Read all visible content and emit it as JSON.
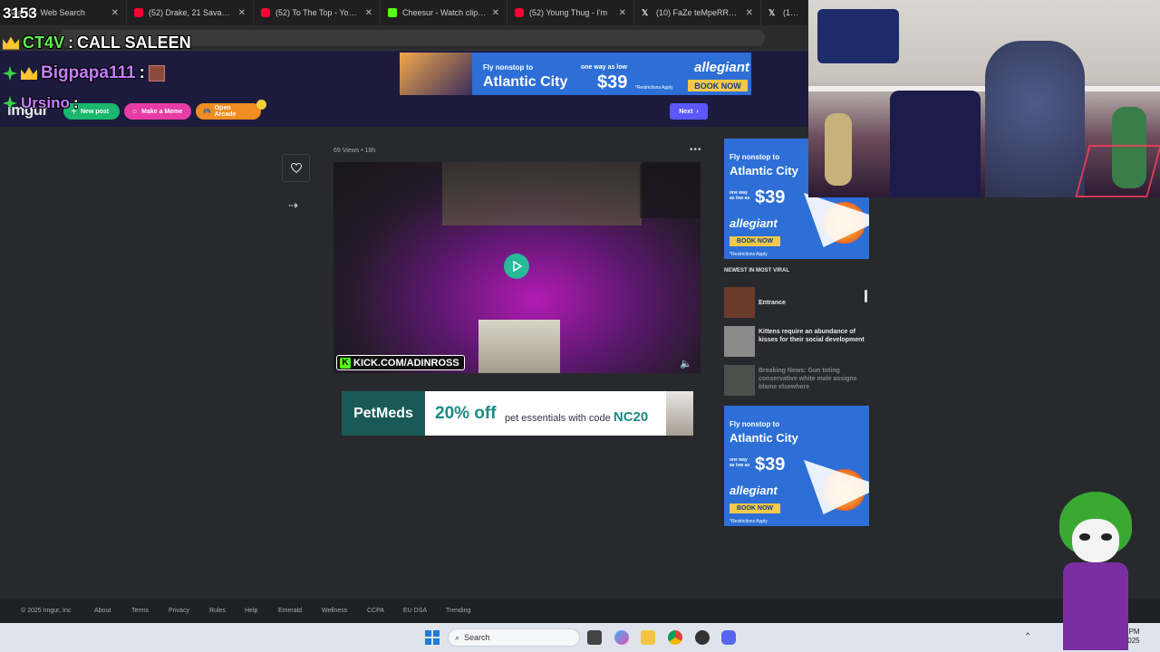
{
  "browser": {
    "tabs": [
      {
        "title": "Search - Web Search",
        "icon": "search-icon"
      },
      {
        "title": "(52) Drake, 21 Savage - Sp",
        "icon": "youtube-icon"
      },
      {
        "title": "(52) To The Top - YouTube",
        "icon": "youtube-icon"
      },
      {
        "title": "Cheesur - Watch clips on K",
        "icon": "kick-icon"
      },
      {
        "title": "(52) Young Thug - I'm",
        "icon": "youtube-icon"
      },
      {
        "title": "(10) FaZe teMpeRRR on X",
        "icon": "x-icon"
      },
      {
        "title": "(10) s",
        "icon": "x-icon"
      }
    ]
  },
  "overlay": {
    "count": "3153",
    "line1_user": "CT4V",
    "line1_sep": ":",
    "line1_msg": "CALL SALEEN",
    "line2_user": "Bigpapa111",
    "line2_sep": ":",
    "line3_user": "Ursino",
    "line3_sep": ":"
  },
  "imgur": {
    "logo": "imgur",
    "new_post": "New post",
    "make_meme": "Make a Meme",
    "open_arcade": "Open Arcade",
    "next": "Next",
    "post_meta": "69 Views • 18h",
    "kick_tag": "KICK.COM/ADINROSS",
    "newest_heading": "NEWEST IN MOST VIRAL",
    "newest": [
      {
        "title": "Entrance"
      },
      {
        "title": "Kittens require an abundance of kisses for their social development"
      },
      {
        "title": "Breaking News: Gun toting conservative white male assigns blame elsewhere"
      }
    ]
  },
  "ads": {
    "top": {
      "l1": "Fly nonstop to",
      "l2": "Atlantic City",
      "oneway": "one way as low",
      "price": "$39",
      "brand": "allegiant",
      "cta": "BOOK NOW",
      "restr": "*Restrictions Apply"
    },
    "side": {
      "l1": "Fly nonstop to",
      "l2": "Atlantic City",
      "oneway": "one way as low as",
      "price": "$39",
      "brand": "allegiant",
      "cta": "BOOK NOW",
      "restr": "*Restrictions Apply"
    },
    "petmeds": {
      "brand": "PetMeds",
      "offer": "20% off",
      "rest_a": "pet essentials with code",
      "code": "NC20"
    }
  },
  "footer": {
    "copyright": "© 2025 Imgur, Inc",
    "links": [
      "About",
      "Terms",
      "Privacy",
      "Rules",
      "Help",
      "Emerald",
      "Wellness",
      "CCPA",
      "EU DSA",
      "Trending"
    ]
  },
  "taskbar": {
    "search": "Search",
    "time": "2:43 PM",
    "date": "9/15/2025"
  },
  "colors": {
    "imgur_header": "#1c1b3d",
    "page_bg": "#27292d",
    "new_post": "#1bb76e",
    "make_meme": "#e73ca5",
    "open_arcade": "#f08d23",
    "next_button": "#5c58ff",
    "ad_blue": "#2d6fd6",
    "ad_cta": "#f4c84a",
    "petmeds_green": "#1a5a56",
    "taskbar": "#dfe4ec"
  }
}
